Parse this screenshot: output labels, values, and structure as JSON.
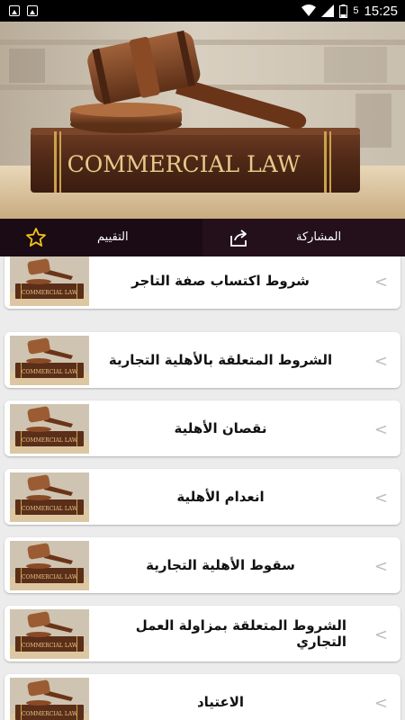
{
  "status_bar": {
    "time": "15:25",
    "battery": "5"
  },
  "banner": {
    "book_title": "COMMERCIAL LAW"
  },
  "actions": {
    "share_label": "المشاركة",
    "rate_label": "التقييم"
  },
  "items": [
    {
      "title": "شروط اكتساب صفة التاجر"
    },
    {
      "title": "الشروط المتعلقة بالأهلية التجارية"
    },
    {
      "title": "نقصان الأهلية"
    },
    {
      "title": "انعدام الأهلية"
    },
    {
      "title": "سقوط الأهلية التجارية"
    },
    {
      "title": "الشروط المتعلقة بمزاولة العمل التجاري"
    },
    {
      "title": "الاعتياد"
    }
  ],
  "chevron": "<",
  "colors": {
    "action_bar": "#23101b",
    "background": "#ececec",
    "card": "#ffffff"
  }
}
